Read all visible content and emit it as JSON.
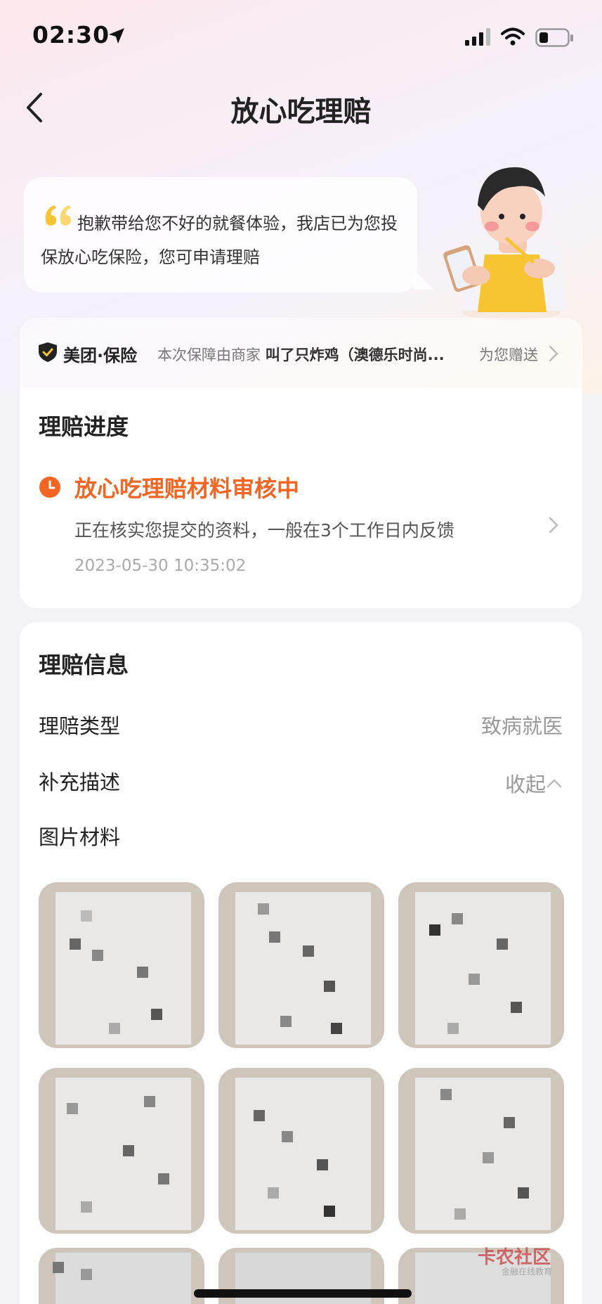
{
  "status_bar": {
    "time": "02:30"
  },
  "nav": {
    "title": "放心吃理赔"
  },
  "bubble": {
    "message": "抱歉带给您不好的就餐体验，我店已为您投保放心吃保险，您可申请理赔"
  },
  "insurance": {
    "brand": "美团·保险",
    "desc_prefix": "本次保障由商家",
    "merchant": "叫了只炸鸡（澳德乐时尚...",
    "gift": "为您赠送"
  },
  "progress": {
    "title": "理赔进度",
    "status": "放心吃理赔材料审核中",
    "desc": "正在核实您提交的资料，一般在3个工作日内反馈",
    "time": "2023-05-30 10:35:02"
  },
  "info": {
    "title": "理赔信息",
    "type_label": "理赔类型",
    "type_value": "致病就医",
    "desc_label": "补充描述",
    "collapse_label": "收起",
    "images_label": "图片材料"
  },
  "watermark": {
    "text": "卡农社区",
    "sub": "金融在线教育"
  },
  "colors": {
    "accent": "#f26522",
    "page_bg": "#f3f3f6"
  }
}
